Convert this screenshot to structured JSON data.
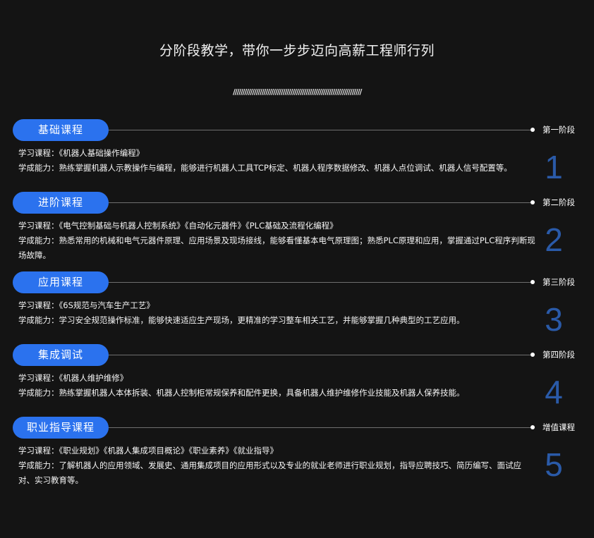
{
  "page": {
    "title": "分阶段教学，带你一步步迈向高薪工程师行列",
    "divider": "///////////////////////////////////////////////////////////////////"
  },
  "stages": [
    {
      "pill": "基础课程",
      "tag": "第一阶段",
      "number": "1",
      "course": "学习课程：《机器人基础操作编程》",
      "ability": "学成能力：熟练掌握机器人示教操作与编程，能够进行机器人工具TCP标定、机器人程序数据修改、机器人点位调试、机器人信号配置等。"
    },
    {
      "pill": "进阶课程",
      "tag": "第二阶段",
      "number": "2",
      "course": "学习课程：《电气控制基础与机器人控制系统》《自动化元器件》《PLC基础及流程化编程》",
      "ability": "学成能力：熟悉常用的机械和电气元器件原理、应用场景及现场接线，能够看懂基本电气原理图；熟悉PLC原理和应用，掌握通过PLC程序判断现场故障。"
    },
    {
      "pill": "应用课程",
      "tag": "第三阶段",
      "number": "3",
      "course": "学习课程：《6S规范与汽车生产工艺》",
      "ability": "学成能力：学习安全规范操作标准，能够快速适应生产现场，更精准的学习整车相关工艺，并能够掌握几种典型的工艺应用。"
    },
    {
      "pill": "集成调试",
      "tag": "第四阶段",
      "number": "4",
      "course": "学习课程：《机器人维护维修》",
      "ability": "学成能力：熟练掌握机器人本体拆装、机器人控制柜常规保养和配件更换，具备机器人维护维修作业技能及机器人保养技能。"
    },
    {
      "pill": "职业指导课程",
      "tag": "增值课程",
      "number": "5",
      "course": "学习课程：《职业规划》《机器人集成项目概论》《职业素养》《就业指导》",
      "ability": "学成能力：了解机器人的应用领域、发展史、通用集成项目的应用形式以及专业的就业老师进行职业规划，指导应聘技巧、简历编写、面试应对、实习教育等。"
    }
  ],
  "colors": {
    "background": "#141414",
    "accent": "#2b72ee",
    "number": "#2a5aa8"
  }
}
